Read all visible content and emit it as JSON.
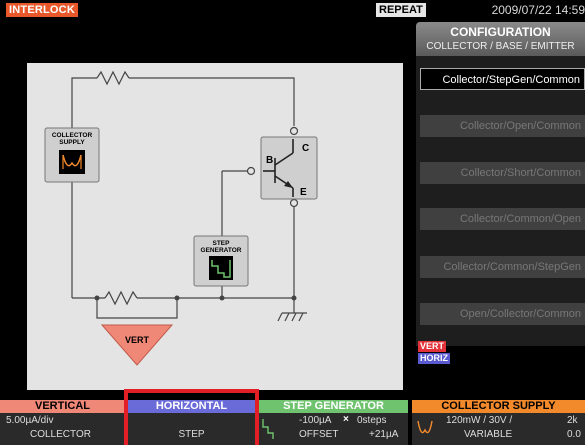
{
  "status_bar": {
    "interlock": "INTERLOCK",
    "repeat": "REPEAT",
    "datetime": "2009/07/22 14:59"
  },
  "config": {
    "title": "CONFIGURATION",
    "subtitle": "COLLECTOR / BASE / EMITTER",
    "options": [
      {
        "label": "Collector/StepGen/Common",
        "selected": true
      },
      {
        "label": "Collector/Open/Common",
        "selected": false
      },
      {
        "label": "Collector/Short/Common",
        "selected": false
      },
      {
        "label": "Collector/Common/Open",
        "selected": false
      },
      {
        "label": "Collector/Common/StepGen",
        "selected": false
      },
      {
        "label": "Open/Collector/Common",
        "selected": false
      }
    ],
    "legend_vert": "VERT",
    "legend_horiz": "HORIZ"
  },
  "diagram": {
    "collector_supply_label": "COLLECTOR SUPPLY",
    "step_generator_label": "STEP GENERATOR",
    "vert_label": "VERT",
    "terminal_b": "B",
    "terminal_c": "C",
    "terminal_e": "E"
  },
  "bottom": {
    "vertical": {
      "title": "VERTICAL",
      "line1": "5.00µA/div",
      "line2": "COLLECTOR"
    },
    "horizontal": {
      "title": "HORIZONTAL",
      "line1": "",
      "line2": "STEP"
    },
    "step_generator": {
      "title": "STEP GENERATOR",
      "line1": "-100µA",
      "times": "×",
      "steps": "0steps",
      "line2a": "OFFSET",
      "line2b": "+21µA"
    },
    "collector_supply": {
      "title": "COLLECTOR SUPPLY",
      "line1": "120mW / 30V /",
      "line1b": "2k",
      "line2": "VARIABLE",
      "line2b": "0.0"
    }
  },
  "colors": {
    "interlock": "#e8582a",
    "vertical": "#f08878",
    "horizontal": "#6a6ad8",
    "step_generator": "#6fc36f",
    "collector_supply": "#f28a2c",
    "highlight_frame": "#e21f26"
  }
}
